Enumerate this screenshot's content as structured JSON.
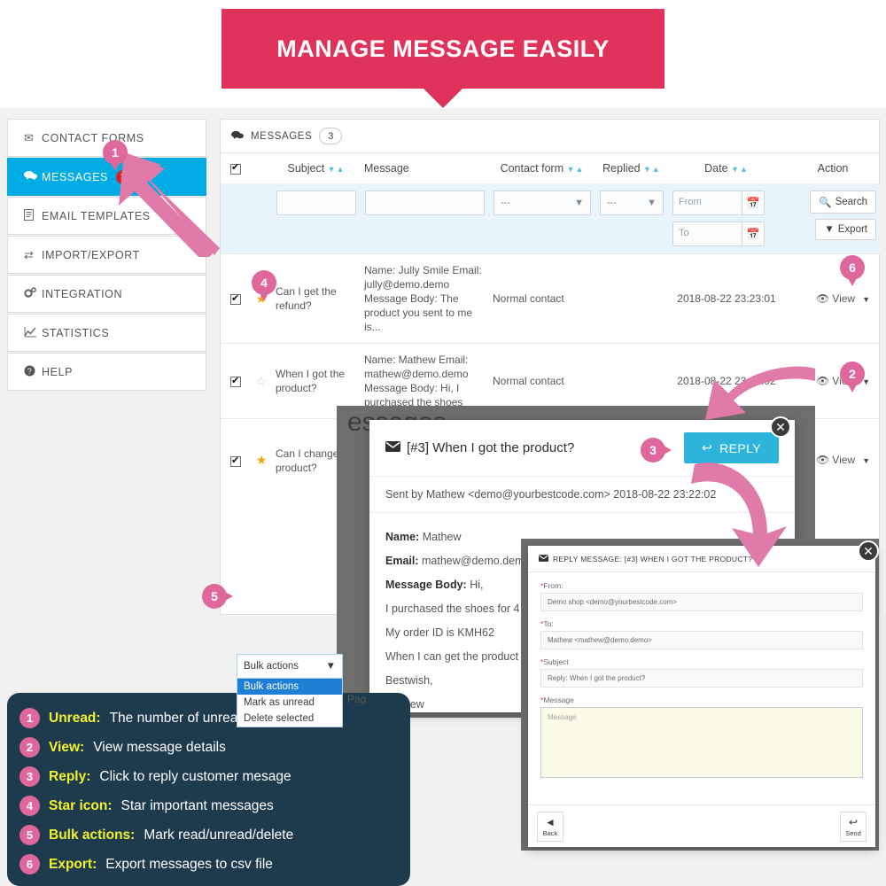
{
  "banner": {
    "title": "MANAGE MESSAGE EASILY"
  },
  "sidebar": {
    "items": [
      {
        "label": "CONTACT FORMS",
        "icon": "envelope-icon",
        "glyph": "✉",
        "active": false,
        "badge": ""
      },
      {
        "label": "MESSAGES",
        "icon": "comments-icon",
        "glyph": "💬",
        "active": true,
        "badge": "1"
      },
      {
        "label": "EMAIL TEMPLATES",
        "icon": "file-text-icon",
        "glyph": "▤",
        "active": false,
        "badge": ""
      },
      {
        "label": "IMPORT/EXPORT",
        "icon": "exchange-icon",
        "glyph": "⇄",
        "active": false,
        "badge": ""
      },
      {
        "label": "INTEGRATION",
        "icon": "gears-icon",
        "glyph": "⚙",
        "active": false,
        "badge": ""
      },
      {
        "label": "STATISTICS",
        "icon": "line-chart-icon",
        "glyph": "↗",
        "active": false,
        "badge": ""
      },
      {
        "label": "HELP",
        "icon": "question-circle-icon",
        "glyph": "❓",
        "active": false,
        "badge": ""
      }
    ]
  },
  "panel": {
    "header_title": "MESSAGES",
    "header_count": "3",
    "columns": [
      "Subject",
      "Message",
      "Contact form",
      "Replied",
      "Date",
      "Action"
    ],
    "filters": {
      "subject_value": "",
      "message_value": "",
      "contact_form_value": "---",
      "replied_value": "---",
      "date_from_placeholder": "From",
      "date_to_placeholder": "To",
      "search_label": "Search",
      "export_label": "Export"
    },
    "rows": [
      {
        "checked": true,
        "starred": true,
        "subject": "Can I get the refund?",
        "message": "Name: Jully Smile Email: jully@demo.demo Message Body: The product you sent to me is...",
        "contact_form": "Normal contact",
        "date": "2018-08-22 23:23:01",
        "action": "View"
      },
      {
        "checked": true,
        "starred": false,
        "subject": "When I got the product?",
        "message": "Name: Mathew Email: mathew@demo.demo Message Body: Hi, I purchased the shoes",
        "contact_form": "Normal contact",
        "date": "2018-08-22 23:22:02",
        "action": "View"
      },
      {
        "checked": true,
        "starred": true,
        "subject": "Can I change the product?",
        "message": "",
        "contact_form": "",
        "date": "",
        "action": "View"
      }
    ]
  },
  "bulk_actions": {
    "selected": "Bulk actions",
    "options": [
      "Bulk actions",
      "Mark as unread",
      "Delete selected"
    ],
    "pagination_text": "Pag"
  },
  "view_modal": {
    "backdrop_ghost": "essages",
    "title": "[#3] When I got the product?",
    "reply_label": "REPLY",
    "sent_by": "Sent by Mathew <demo@yourbestcode.com> 2018-08-22 23:22:02",
    "fields": [
      {
        "label": "Name:",
        "value": "Mathew"
      },
      {
        "label": "Email:",
        "value": "mathew@demo.demo"
      },
      {
        "label": "Message Body:",
        "value": "Hi,"
      }
    ],
    "body_lines": [
      "I purchased the shoes for 4",
      "My order ID is KMH62",
      "When I can get the product",
      "Bestwish,",
      "Mathew"
    ]
  },
  "reply_modal": {
    "title": "REPLY MESSAGE: [#3] WHEN I GOT THE PRODUCT?",
    "from_label": "From:",
    "from_value": "Demo shop <demo@yourbestcode.com>",
    "to_label": "To:",
    "to_value": "Mathew <mathew@demo.demo>",
    "subject_label": "Subject",
    "subject_value": "Reply: When I got the product?",
    "message_label": "Message",
    "message_placeholder": "Message",
    "back_label": "Back",
    "send_label": "Send"
  },
  "markers": {
    "m1": "1",
    "m2": "2",
    "m3": "3",
    "m4": "4",
    "m5": "5",
    "m6": "6"
  },
  "legend": {
    "items": [
      {
        "num": "1",
        "key": "Unread:",
        "desc": "The number of unread messages"
      },
      {
        "num": "2",
        "key": "View:",
        "desc": "View message details"
      },
      {
        "num": "3",
        "key": "Reply:",
        "desc": "Click to reply customer mesage"
      },
      {
        "num": "4",
        "key": "Star icon:",
        "desc": "Star important messages"
      },
      {
        "num": "5",
        "key": "Bulk actions:",
        "desc": "Mark read/unread/delete"
      },
      {
        "num": "6",
        "key": "Export:",
        "desc": "Export messages to csv file"
      }
    ]
  },
  "colors": {
    "brand_pink": "#e0335c",
    "accent_blue": "#00ace3",
    "marker_pink": "#e0679c",
    "legend_bg": "#1e3b4d",
    "legend_key": "#f2f230",
    "star_gold": "#f0a414",
    "badge_red": "#cf2525"
  }
}
